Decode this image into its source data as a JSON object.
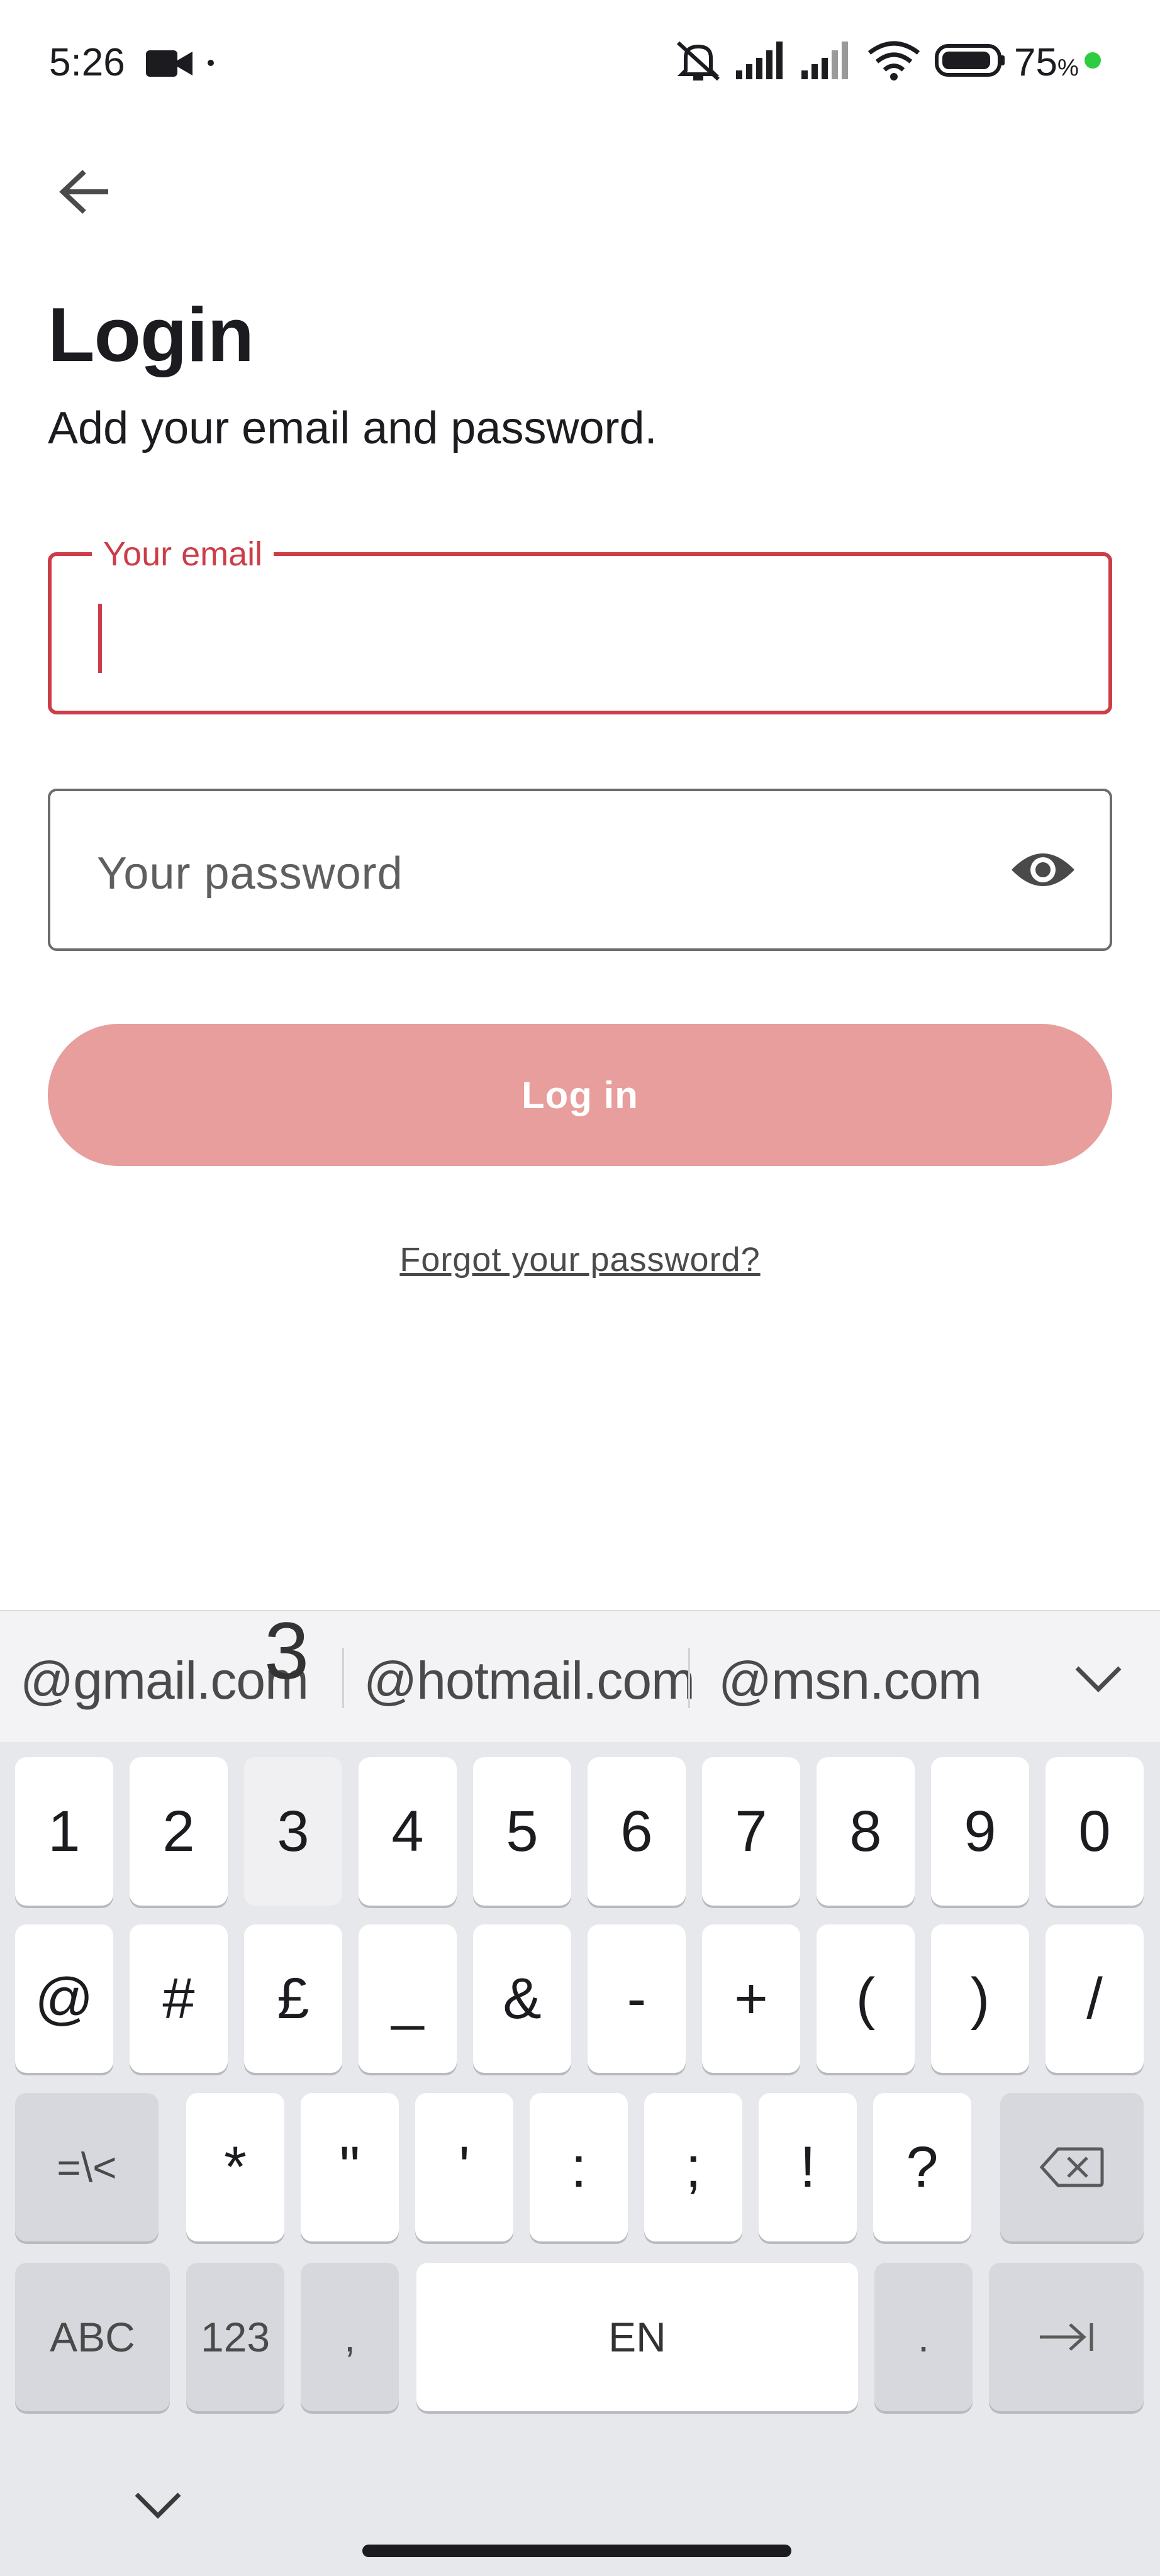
{
  "status_bar": {
    "time": "5:26",
    "battery_percent": "75",
    "battery_unit": "%",
    "icons": [
      "video-camera-icon",
      "dot-icon",
      "silent-icon",
      "signal-icon",
      "signal-icon",
      "wifi-icon",
      "battery-icon",
      "charging-dot"
    ]
  },
  "header": {
    "back_icon": "arrow-left-icon",
    "title": "Login",
    "subtitle": "Add your email and password."
  },
  "form": {
    "email": {
      "label": "Your email",
      "value": ""
    },
    "password": {
      "placeholder": "Your password",
      "toggle_icon": "eye-icon"
    },
    "login_label": "Log in",
    "forgot_label": "Forgot your password?"
  },
  "colors": {
    "accent": "#cc3d47",
    "button_disabled": "#e79e9c",
    "keyboard_bg": "#e7e8ec"
  },
  "keyboard": {
    "popup_char": "3",
    "suggestions": [
      "@gmail.com",
      "@hotmail.com",
      "@msn.com"
    ],
    "row1": [
      "1",
      "2",
      "3",
      "4",
      "5",
      "6",
      "7",
      "8",
      "9",
      "0"
    ],
    "row2": [
      "@",
      "#",
      "£",
      "_",
      "&",
      "-",
      "+",
      "(",
      ")",
      "/"
    ],
    "row3": [
      "=\\<",
      "*",
      "\"",
      "'",
      ":",
      ";",
      "!",
      "?"
    ],
    "row4": {
      "abc": "ABC",
      "num": "123",
      "comma": ",",
      "space": "EN",
      "period": "."
    }
  }
}
